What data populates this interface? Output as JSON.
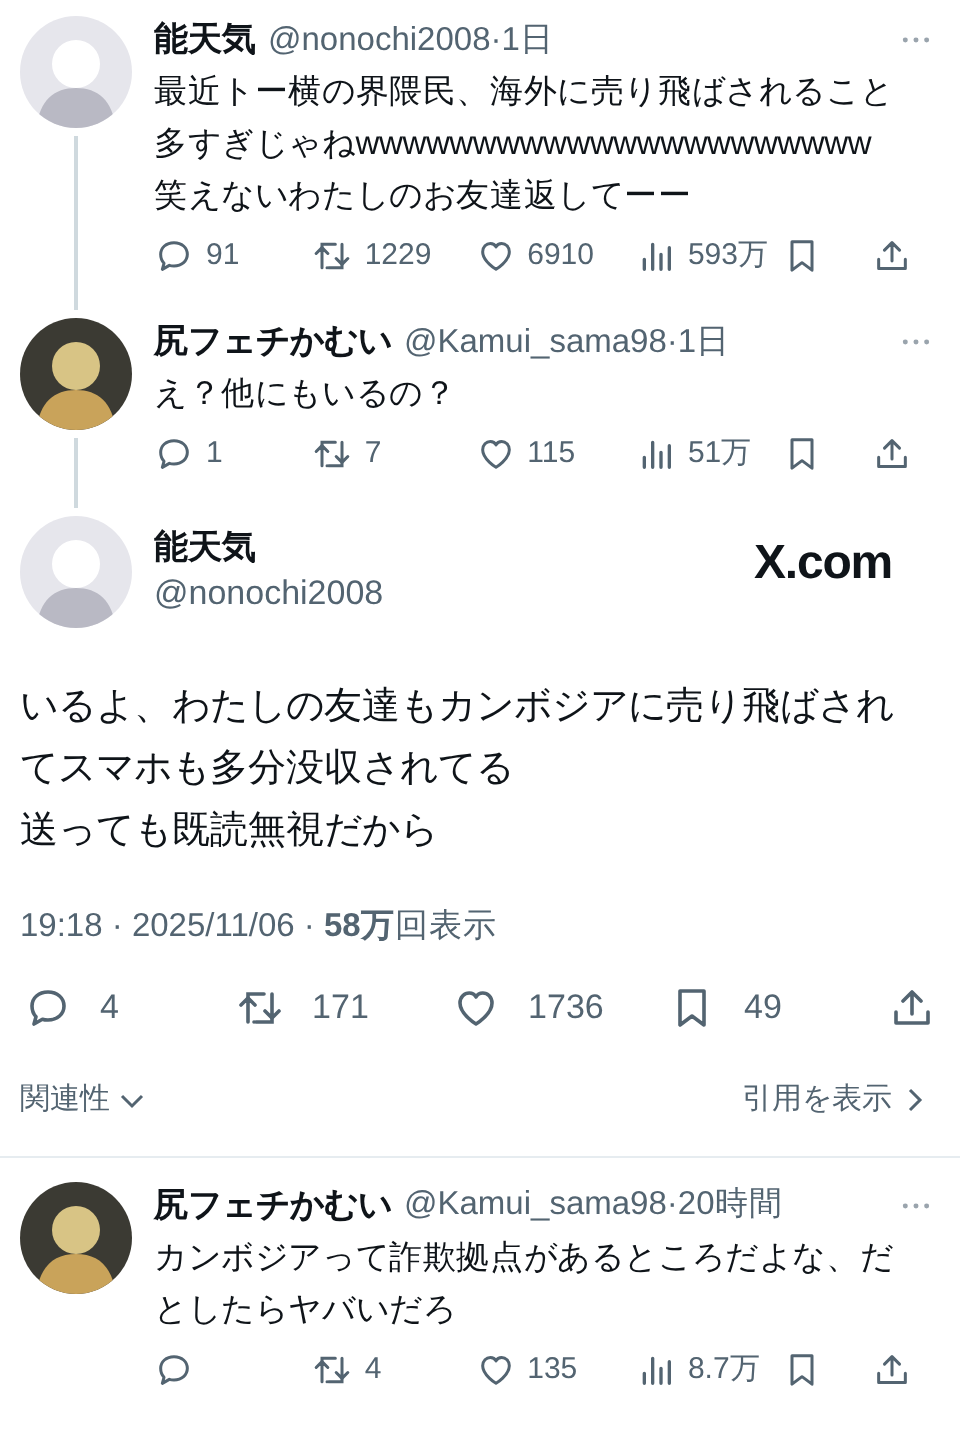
{
  "thread": [
    {
      "name": "能天気",
      "handle": "@nonochi2008",
      "time": "·1日",
      "text": "最近トー横の界隈民、海外に売り飛ばされること多すぎじゃねwwwwwwwwwwwwwwwwwwwwww笑えないわたしのお友達返してーー",
      "actions": [
        {
          "kind": "reply",
          "count": "91"
        },
        {
          "kind": "repost",
          "count": "1229"
        },
        {
          "kind": "like",
          "count": "6910"
        },
        {
          "kind": "views",
          "count": "593万"
        },
        {
          "kind": "bookmark"
        },
        {
          "kind": "share"
        }
      ]
    },
    {
      "name": "尻フェチかむい",
      "handle": "@Kamui_sama98",
      "time": "·1日",
      "text": "え？他にもいるの？",
      "actions": [
        {
          "kind": "reply",
          "count": "1"
        },
        {
          "kind": "repost",
          "count": "7"
        },
        {
          "kind": "like",
          "count": "115"
        },
        {
          "kind": "views",
          "count": "51万"
        },
        {
          "kind": "bookmark"
        },
        {
          "kind": "share"
        }
      ]
    }
  ],
  "main_tweet": {
    "name": "能天気",
    "handle": "@nonochi2008",
    "logo": "X.com",
    "paragraphs": [
      "いるよ、わたしの友達もカンボジアに売り飛ばされてスマホも多分没収されてる",
      "送っても既読無視だから"
    ],
    "meta": "19:18 · 2025/11/06 · **58万**回表示",
    "actions": [
      {
        "kind": "reply",
        "count": "4"
      },
      {
        "kind": "repost",
        "count": "171"
      },
      {
        "kind": "like",
        "count": "1736"
      },
      {
        "kind": "bookmark",
        "count": "49"
      },
      {
        "kind": "share"
      }
    ],
    "sort": "関連性",
    "quotes": "引用を表示"
  },
  "replies": [
    {
      "name": "尻フェチかむい",
      "handle": "@Kamui_sama98",
      "time": "·20時間",
      "text": "カンボジアって詐欺拠点があるところだよな、だとしたらヤバいだろ",
      "actions": [
        {
          "kind": "reply"
        },
        {
          "kind": "repost",
          "count": "4"
        },
        {
          "kind": "like",
          "count": "135"
        },
        {
          "kind": "views",
          "count": "8.7万"
        },
        {
          "kind": "bookmark"
        },
        {
          "kind": "share"
        }
      ]
    }
  ]
}
